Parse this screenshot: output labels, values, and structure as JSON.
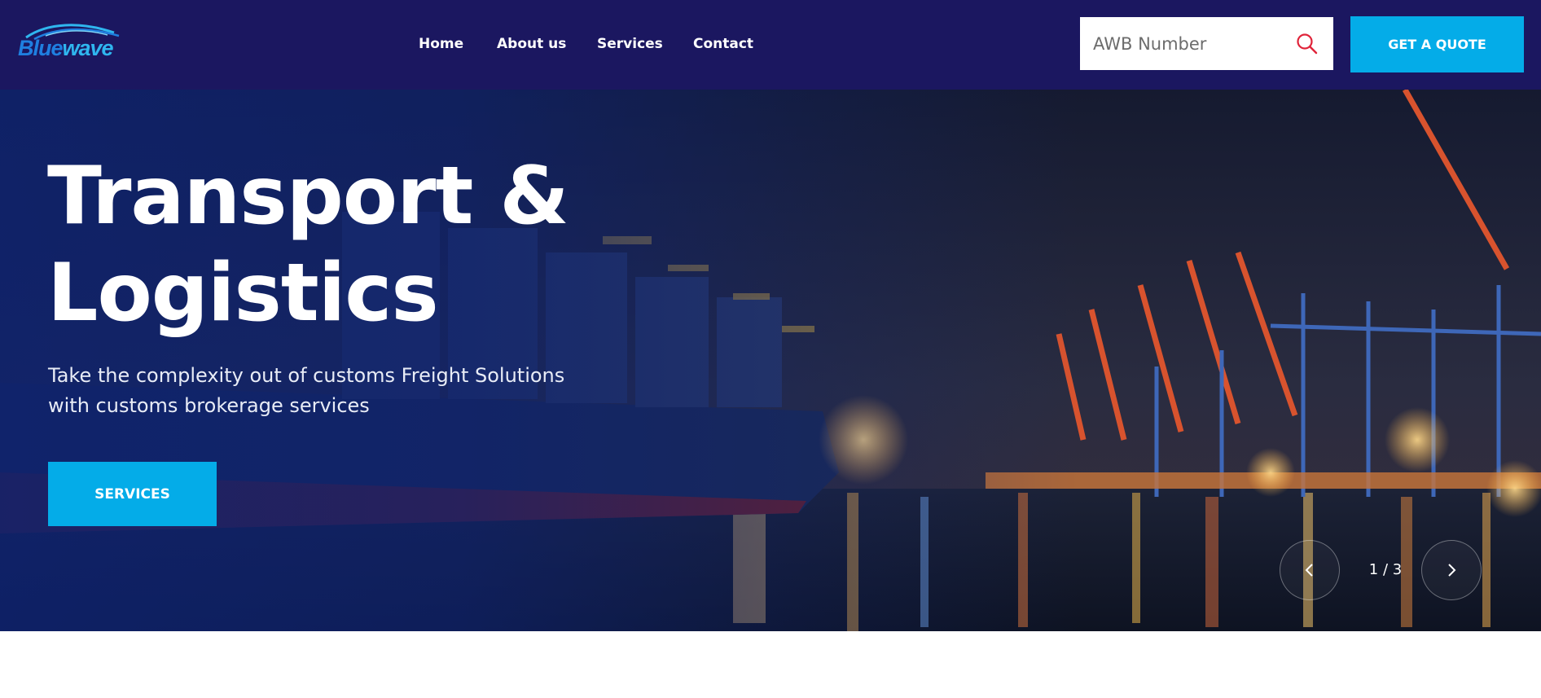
{
  "brand": {
    "logo_part1": "Blue",
    "logo_part2": "wave",
    "primary_color": "#1b1760",
    "accent_color": "#04ace8"
  },
  "nav": {
    "items": [
      {
        "label": "Home"
      },
      {
        "label": "About us"
      },
      {
        "label": "Services"
      },
      {
        "label": "Contact"
      }
    ]
  },
  "search": {
    "placeholder": "AWB Number",
    "value": "",
    "icon": "search-icon"
  },
  "header": {
    "quote_button": "GET A QUOTE"
  },
  "hero": {
    "title_line1": "Transport &",
    "title_line2": "Logistics",
    "subtitle_line1": "Take the complexity out of customs Freight Solutions",
    "subtitle_line2": "with customs brokerage services",
    "button_label": "SERVICES",
    "background": "night-port-with-cargo-ship-and-cranes"
  },
  "slider": {
    "counter": "1 / 3",
    "prev_icon": "chevron-left-icon",
    "next_icon": "chevron-right-icon"
  }
}
